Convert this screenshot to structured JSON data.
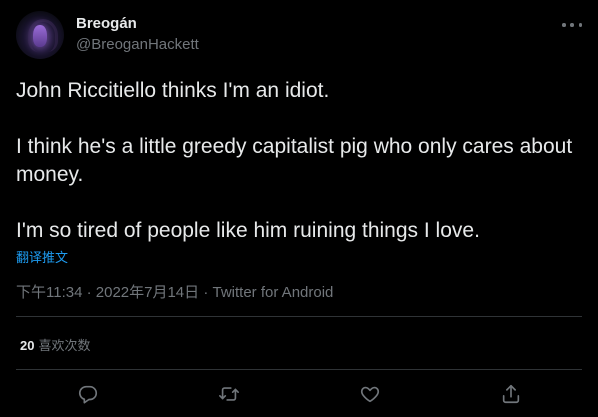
{
  "author": {
    "name": "Breogán",
    "handle": "@BreoganHackett"
  },
  "tweet": {
    "paragraphs": [
      "John Riccitiello thinks I'm an idiot.",
      "I think he's a little greedy capitalist pig who only cares about money.",
      "I'm so tired of people like him ruining things I love."
    ],
    "translate_label": "翻译推文",
    "timestamp": "下午11:34 · 2022年7月14日",
    "separator": " · ",
    "source": "Twitter for Android"
  },
  "stats": {
    "likes_count": "20",
    "likes_label": "喜欢次数"
  },
  "actions": {
    "reply_icon": "reply-icon",
    "retweet_icon": "retweet-icon",
    "like_icon": "heart-icon",
    "share_icon": "share-icon"
  },
  "colors": {
    "background": "#000000",
    "text": "#e7e9ea",
    "secondary": "#71767b",
    "accent": "#1d9bf0",
    "divider": "#2f3336"
  }
}
